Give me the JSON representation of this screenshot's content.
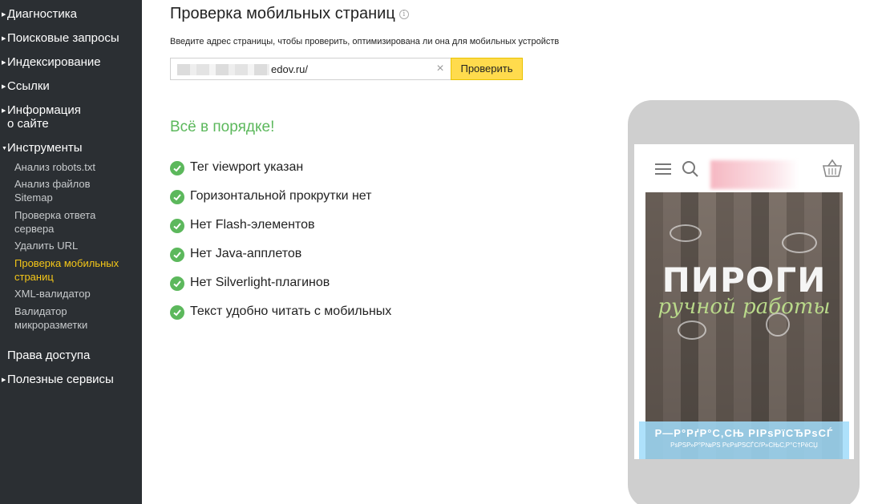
{
  "sidebar": {
    "items": [
      {
        "label": "Диагностика",
        "arrow": "▶"
      },
      {
        "label": "Поисковые запросы",
        "arrow": "▶"
      },
      {
        "label": "Индексирование",
        "arrow": "▶"
      },
      {
        "label": "Ссылки",
        "arrow": "▶"
      },
      {
        "label": "Информация\nо сайте",
        "arrow": "▶"
      },
      {
        "label": "Инструменты",
        "arrow": "▼"
      },
      {
        "label": "Права доступа",
        "arrow": ""
      },
      {
        "label": "Полезные сервисы",
        "arrow": "▶"
      }
    ],
    "tools_subitems": [
      {
        "label": "Анализ robots.txt"
      },
      {
        "label": "Анализ файлов Sitemap"
      },
      {
        "label": "Проверка ответа сервера"
      },
      {
        "label": "Удалить URL"
      },
      {
        "label": "Проверка мобильных страниц",
        "active": true
      },
      {
        "label": "XML-валидатор"
      },
      {
        "label": "Валидатор микроразметки"
      }
    ],
    "active_color": "#f5c718"
  },
  "main": {
    "title": "Проверка мобильных страниц",
    "info_icon": "i",
    "hint": "Введите адрес страницы, чтобы проверить, оптимизирована ли она для мобильных устройств",
    "url_value": "edov.ru/",
    "clear_icon": "×",
    "check_button": "Проверить",
    "result_title": "Всё в порядке!",
    "checks": [
      "Тег viewport указан",
      "Горизонтальной прокрутки нет",
      "Нет Flash-элементов",
      "Нет Java-апплетов",
      "Нет Silverlight-плагинов",
      "Текст удобно читать с мобильных"
    ],
    "success_color": "#5cb85c"
  },
  "preview": {
    "hero_title": "ПИРОГИ",
    "hero_subtitle": "ручной работы",
    "banner_line1": "Р—Р°РґР°С‚СЊ РІРѕРїСЂРѕСЃ",
    "banner_line2": "РѕРЅР»Р°Р№РЅ РєРѕРЅСЃСѓР»СЊС‚Р°С†РёСЏ"
  }
}
